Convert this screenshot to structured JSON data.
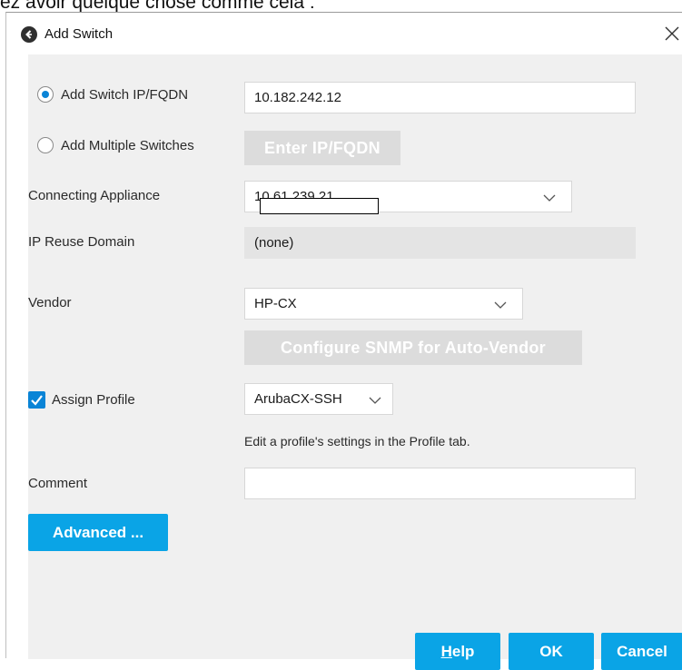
{
  "clip_text": "ez avoir quelque chose comme cela :",
  "dialog": {
    "title": "Add Switch",
    "close_glyph": "✕",
    "app_icon": "back-arrow-icon"
  },
  "form": {
    "radio_single": {
      "label": "Add Switch IP/FQDN",
      "selected": true,
      "value": "10.182.242.12"
    },
    "radio_multiple": {
      "label": "Add Multiple Switches",
      "selected": false,
      "button": "Enter IP/FQDN"
    },
    "connecting_appliance": {
      "label": "Connecting Appliance",
      "value": "10.61.239.21"
    },
    "ip_reuse_domain": {
      "label": "IP Reuse Domain",
      "value": "(none)"
    },
    "vendor": {
      "label": "Vendor",
      "value": "HP-CX",
      "snmp_button": "Configure SNMP for Auto-Vendor"
    },
    "assign_profile": {
      "label": "Assign Profile",
      "checked": true,
      "value": "ArubaCX-SSH",
      "hint": "Edit a profile's settings in the Profile tab."
    },
    "comment": {
      "label": "Comment",
      "value": ""
    }
  },
  "buttons": {
    "advanced": "Advanced ...",
    "help": "Help",
    "help_mnemonic": "H",
    "help_rest": "elp",
    "ok": "OK",
    "cancel": "Cancel"
  },
  "colors": {
    "accent": "#0aa4e6",
    "panel_bg": "#f0f0f0",
    "disabled_button": "#dcdcdc"
  }
}
